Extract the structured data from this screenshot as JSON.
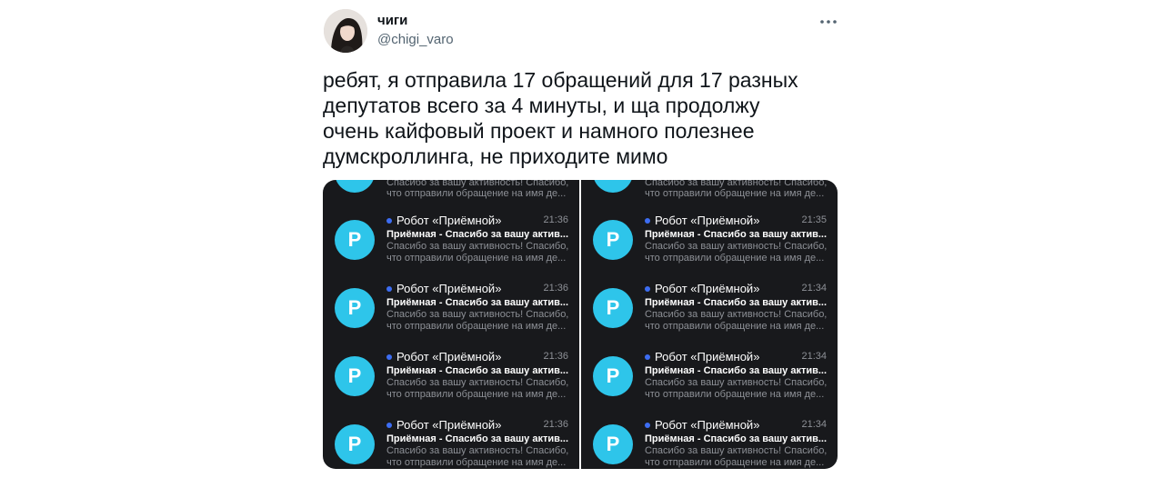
{
  "tweet": {
    "display_name": "чиги",
    "handle": "@chigi_varo",
    "more_icon": "more-horizontal-icon",
    "text_lines": [
      "ребят, я отправила 17 обращений для 17 разных",
      "депутатов всего за 4 минуты, и ща продолжу",
      "очень кайфовый проект и намного полезнее",
      "думскроллинга, не приходите мимо"
    ]
  },
  "media": {
    "avatar_letter": "P",
    "top_preview_lines": [
      "Спасибо за вашу активность! Спасибо,",
      "что отправили обращение на имя де..."
    ],
    "left_panel": [
      {
        "sender": "Робот «Приёмной»",
        "time": "21:36",
        "subject": "Приёмная - Спасибо за вашу актив...",
        "preview1": "Спасибо за вашу активность! Спасибо,",
        "preview2": "что отправили обращение на имя де..."
      },
      {
        "sender": "Робот «Приёмной»",
        "time": "21:36",
        "subject": "Приёмная - Спасибо за вашу актив...",
        "preview1": "Спасибо за вашу активность! Спасибо,",
        "preview2": "что отправили обращение на имя де..."
      },
      {
        "sender": "Робот «Приёмной»",
        "time": "21:36",
        "subject": "Приёмная - Спасибо за вашу актив...",
        "preview1": "Спасибо за вашу активность! Спасибо,",
        "preview2": "что отправили обращение на имя де..."
      },
      {
        "sender": "Робот «Приёмной»",
        "time": "21:36",
        "subject": "Приёмная - Спасибо за вашу актив...",
        "preview1": "Спасибо за вашу активность! Спасибо,",
        "preview2": "что отправили обращение на имя де..."
      }
    ],
    "right_panel": [
      {
        "sender": "Робот «Приёмной»",
        "time": "21:35",
        "subject": "Приёмная - Спасибо за вашу актив...",
        "preview1": "Спасибо за вашу активность! Спасибо,",
        "preview2": "что отправили обращение на имя де..."
      },
      {
        "sender": "Робот «Приёмной»",
        "time": "21:34",
        "subject": "Приёмная - Спасибо за вашу актив...",
        "preview1": "Спасибо за вашу активность! Спасибо,",
        "preview2": "что отправили обращение на имя де..."
      },
      {
        "sender": "Робот «Приёмной»",
        "time": "21:34",
        "subject": "Приёмная - Спасибо за вашу актив...",
        "preview1": "Спасибо за вашу активность! Спасибо,",
        "preview2": "что отправили обращение на имя де..."
      },
      {
        "sender": "Робот «Приёмной»",
        "time": "21:34",
        "subject": "Приёмная - Спасибо за вашу актив...",
        "preview1": "Спасибо за вашу активность! Спасибо,",
        "preview2": "что отправили обращение на имя де..."
      }
    ]
  },
  "colors": {
    "panel_bg": "#18191c",
    "avatar_p": "#2ec5ea",
    "unread_dot": "#3d6df2",
    "muted_text": "#536471"
  }
}
